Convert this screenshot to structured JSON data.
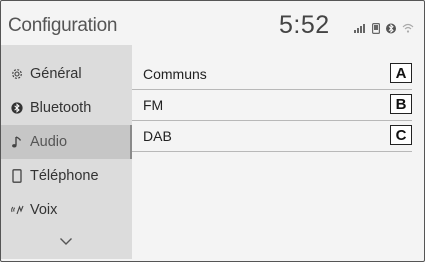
{
  "header": {
    "title": "Configuration",
    "time": "5:52"
  },
  "status": {
    "icons": [
      "signal-icon",
      "phone-icon",
      "bluetooth-icon",
      "wifi-icon"
    ]
  },
  "sidebar": {
    "items": [
      {
        "label": "Général",
        "icon": "gear-icon"
      },
      {
        "label": "Bluetooth",
        "icon": "bluetooth-icon"
      },
      {
        "label": "Audio",
        "icon": "music-note-icon",
        "active": true
      },
      {
        "label": "Téléphone",
        "icon": "phone-icon"
      },
      {
        "label": "Voix",
        "icon": "voice-icon"
      }
    ],
    "more_icon": "chevron-down-icon"
  },
  "main": {
    "rows": [
      {
        "label": "Communs",
        "badge": "A"
      },
      {
        "label": "FM",
        "badge": "B"
      },
      {
        "label": "DAB",
        "badge": "C"
      }
    ]
  }
}
